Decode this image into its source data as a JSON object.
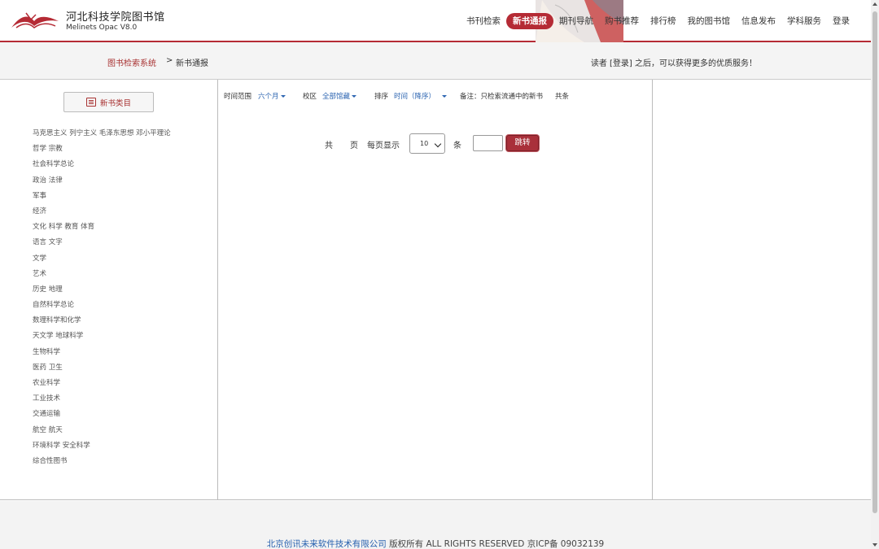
{
  "brand": {
    "title": "河北科技学院图书馆",
    "subtitle": "Melinets Opac V8.0",
    "accent": "#b52b35"
  },
  "nav": {
    "items": [
      {
        "label": "书刊检索",
        "active": false
      },
      {
        "label": "新书通报",
        "active": true
      },
      {
        "label": "期刊导航",
        "active": false
      },
      {
        "label": "购书推荐",
        "active": false
      },
      {
        "label": "排行榜",
        "active": false
      },
      {
        "label": "我的图书馆",
        "active": false
      },
      {
        "label": "信息发布",
        "active": false
      },
      {
        "label": "学科服务",
        "active": false
      },
      {
        "label": "登录",
        "active": false
      }
    ]
  },
  "breadcrumb": {
    "link": "图书检索系统",
    "separator": ">",
    "current": "新书通报"
  },
  "login_tip": "读者 [登录] 之后，可以获得更多的优质服务！",
  "sidebar": {
    "button_label": "新书类目",
    "button_icon": "list-icon",
    "categories": [
      "马克思主义 列宁主义 毛泽东思想 邓小平理论",
      "哲学 宗教",
      "社会科学总论",
      "政治 法律",
      "军事",
      "经济",
      "文化 科学 教育 体育",
      "语言 文字",
      "文学",
      "艺术",
      "历史 地理",
      "自然科学总论",
      "数理科学和化学",
      "天文学 地球科学",
      "生物科学",
      "医药 卫生",
      "农业科学",
      "工业技术",
      "交通运输",
      "航空 航天",
      "环境科学 安全科学",
      "综合性图书"
    ]
  },
  "filters": {
    "time_label": "时间范围",
    "time_value": "六个月",
    "campus_label": "校区",
    "campus_value": "全部馆藏",
    "sort_label": "排序",
    "sort_value": "时间（降序）",
    "note": "备注：只检索流通中的新书",
    "total_label": "共条"
  },
  "pager": {
    "total_prefix": "共",
    "pages_suffix": "页",
    "per_page_label": "每页显示",
    "per_page_value": "10",
    "items_suffix": "条",
    "jump_input": "",
    "jump_label": "跳转"
  },
  "footer": {
    "company": "北京创讯未来软件技术有限公司",
    "rights": " 版权所有 ALL RIGHTS RESERVED 京ICP备 09032139"
  }
}
